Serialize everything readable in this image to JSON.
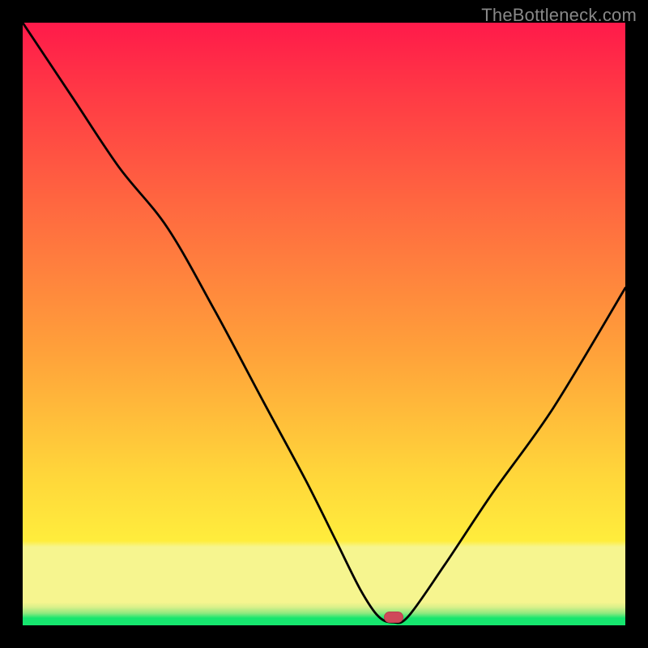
{
  "attribution": "TheBottleneck.com",
  "marker": {
    "x_pct": 61.5,
    "y_pct": 98.6
  },
  "colors": {
    "frame": "#000000",
    "top": "#ff1a4a",
    "mid": "#ffd63a",
    "pale_band": "#f6f58f",
    "green": "#16e66e",
    "curve": "#000000",
    "marker": "#cf485a",
    "attribution": "#888888"
  },
  "chart_data": {
    "type": "line",
    "title": "",
    "xlabel": "",
    "ylabel": "",
    "xlim": [
      0,
      100
    ],
    "ylim": [
      0,
      100
    ],
    "series": [
      {
        "name": "bottleneck-curve",
        "x": [
          0,
          8,
          16,
          24,
          32,
          40,
          47,
          52,
          56,
          59,
          61.5,
          64,
          70,
          78,
          88,
          100
        ],
        "y": [
          100,
          88,
          76,
          66,
          52,
          37,
          24,
          14,
          6,
          1.5,
          0.5,
          1.5,
          10,
          22,
          36,
          56
        ]
      }
    ],
    "marker_point": {
      "x": 61.5,
      "y": 0.5
    },
    "background_gradient_note": "vertical red→orange→yellow with pale-yellow band and thin green strip at bottom"
  }
}
